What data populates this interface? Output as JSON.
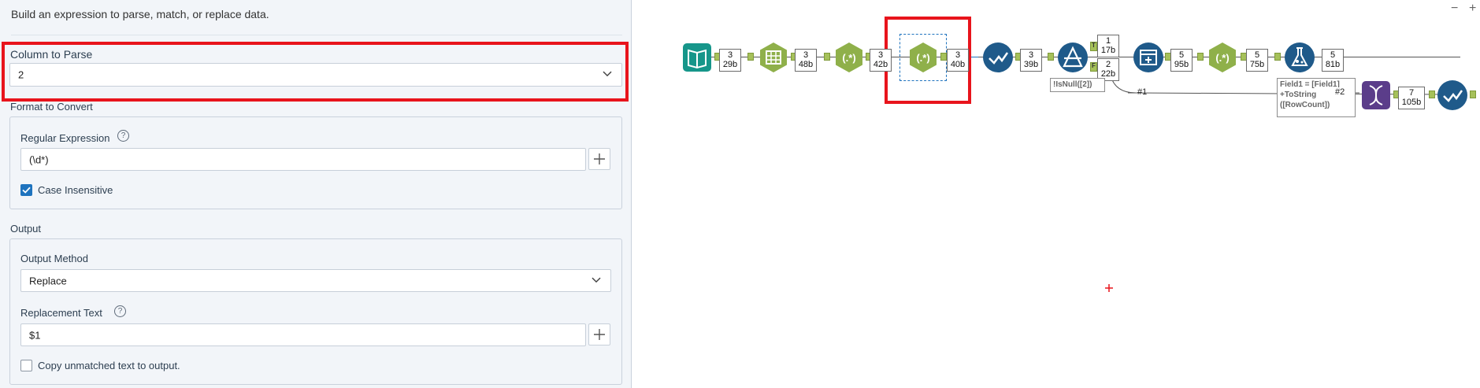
{
  "panel": {
    "description": "Build an expression to parse, match, or replace data.",
    "column_to_parse": {
      "label": "Column to Parse",
      "value": "2"
    },
    "format_to_convert": {
      "label": "Format to Convert"
    },
    "regular_expression": {
      "label": "Regular Expression",
      "value": "(\\d*)",
      "help": "?"
    },
    "case_insensitive": {
      "label": "Case Insensitive",
      "checked": true
    },
    "output": {
      "label": "Output"
    },
    "output_method": {
      "label": "Output Method",
      "value": "Replace"
    },
    "replacement_text": {
      "label": "Replacement Text",
      "value": "$1",
      "help": "?"
    },
    "copy_unmatched": {
      "label": "Copy unmatched text to output.",
      "checked": false
    }
  },
  "canvas": {
    "badges": [
      {
        "count": "3",
        "size": "29b"
      },
      {
        "count": "3",
        "size": "48b"
      },
      {
        "count": "3",
        "size": "42b"
      },
      {
        "count": "3",
        "size": "40b"
      },
      {
        "count": "3",
        "size": "39b"
      },
      {
        "count": "1",
        "size": "17b"
      },
      {
        "count": "2",
        "size": "22b"
      },
      {
        "count": "5",
        "size": "95b"
      },
      {
        "count": "5",
        "size": "75b"
      },
      {
        "count": "5",
        "size": "81b"
      },
      {
        "count": "7",
        "size": "105b"
      }
    ],
    "filter_annotation": "!IsNull([2])",
    "formula_annotation_lines": [
      "Field1 = [Field1]",
      "+ToString",
      "([RowCount])"
    ],
    "true_anchor": "T",
    "false_anchor": "F",
    "wire_label_1": "#1",
    "wire_label_2": "#2",
    "minimize_glyph": "−",
    "maximize_glyph": "+"
  },
  "colors": {
    "highlight": "#e8141c",
    "tool_green": "#8fb04a",
    "tool_blue": "#1f5a8a",
    "tool_teal": "#16968a",
    "tool_purple": "#5b3d8a",
    "accent_blue": "#1e73be"
  }
}
